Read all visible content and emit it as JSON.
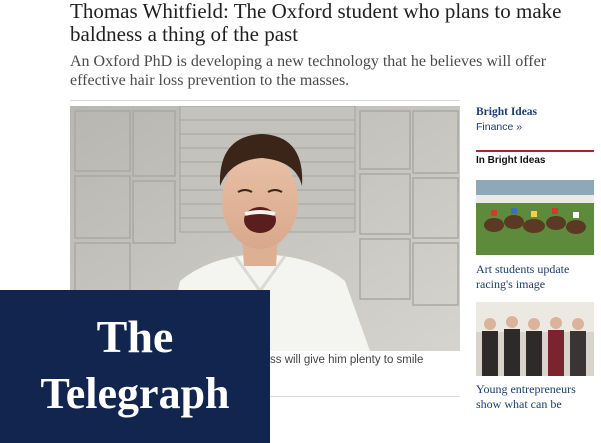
{
  "article": {
    "headline": "Thomas Whitfield: The Oxford student who plans to make baldness a thing of the past",
    "standfirst": "An Oxford PhD is developing a new technology that he believes will offer effective hair loss prevention to the masses.",
    "caption": "ss will give him plenty to smile"
  },
  "sidebar": {
    "title": "Bright Ideas",
    "link": "Finance »",
    "section": "In Bright Ideas",
    "items": [
      {
        "label": "Art students update racing's image"
      },
      {
        "label": "Young entrepreneurs show what can be"
      }
    ]
  },
  "logo": {
    "line1": "The",
    "line2": "Telegraph"
  },
  "colors": {
    "navy": "#12254f",
    "link": "#1d3c6e",
    "accent_red": "#b3212b"
  }
}
